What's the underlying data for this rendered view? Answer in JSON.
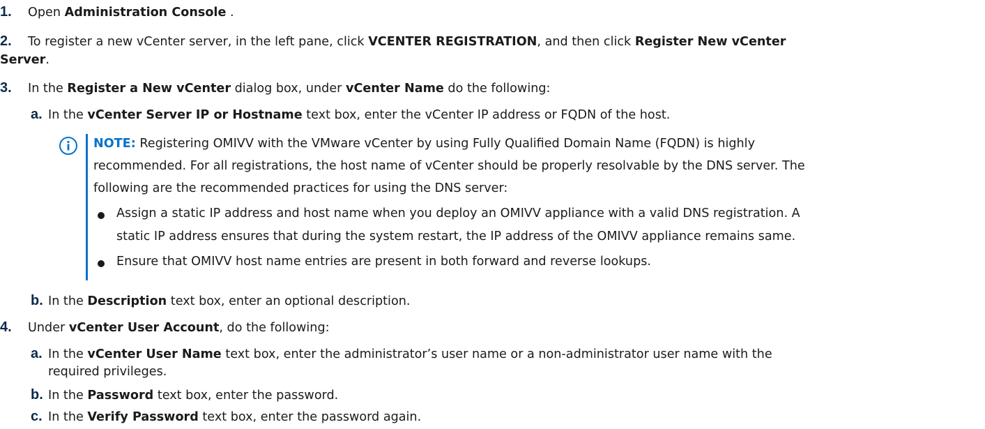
{
  "steps": {
    "s1": {
      "num": "1.",
      "pre": "Open ",
      "b1": "Administration Console",
      "post": " ."
    },
    "s2": {
      "num": "2.",
      "pre": "To register a new vCenter server, in the left pane, click ",
      "b1": "VCENTER REGISTRATION",
      "mid": ", and then click ",
      "b2": "Register New vCenter",
      "b3": "Server",
      "post": "."
    },
    "s3": {
      "num": "3.",
      "pre": "In the ",
      "b1": "Register a New vCenter",
      "mid": " dialog box, under ",
      "b2": "vCenter Name",
      "post": " do the following:"
    },
    "s3a": {
      "letter": "a.",
      "pre": "In the ",
      "b1": "vCenter Server IP or Hostname",
      "post": " text box, enter the vCenter IP address or FQDN of the host."
    },
    "note": {
      "icon": "info-icon",
      "label": "NOTE:",
      "line1": " Registering OMIVV with the VMware vCenter by using Fully Qualified Domain Name (FQDN) is highly",
      "line2": "recommended. For all registrations, the host name of vCenter should be properly resolvable by the DNS server. The",
      "line3": "following are the recommended practices for using the DNS server:",
      "bullet1_l1": "Assign a static IP address and host name when you deploy an OMIVV appliance with a valid DNS registration. A",
      "bullet1_l2": "static IP address ensures that during the system restart, the IP address of the OMIVV appliance remains same.",
      "bullet2": "Ensure that OMIVV host name entries are present in both forward and reverse lookups."
    },
    "s3b": {
      "letter": "b.",
      "pre": "In the ",
      "b1": "Description",
      "post": " text box, enter an optional description."
    },
    "s4": {
      "num": "4.",
      "pre": "Under ",
      "b1": "vCenter User Account",
      "post": ", do the following:"
    },
    "s4a": {
      "letter": "a.",
      "pre": "In the ",
      "b1": "vCenter User Name",
      "post": " text box, enter the administrator’s user name or a non-administrator user name with the",
      "l2": "required privileges."
    },
    "s4b": {
      "letter": "b.",
      "pre": "In the ",
      "b1": "Password",
      "post": " text box, enter the password."
    },
    "s4c": {
      "letter": "c.",
      "pre": "In the ",
      "b1": "Verify Password",
      "post": " text box, enter the password again."
    }
  },
  "colors": {
    "accent": "#0672cb",
    "number": "#0b2a4a",
    "text": "#1b1b1b"
  }
}
